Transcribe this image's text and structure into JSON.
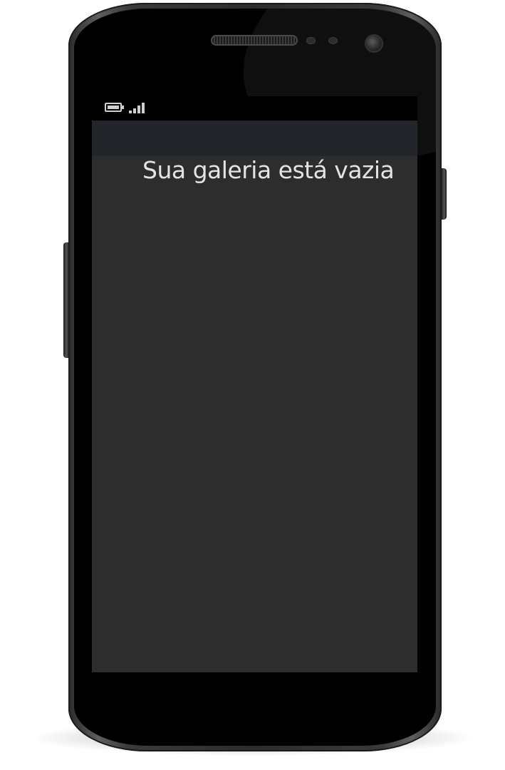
{
  "device": {
    "frame_colors": {
      "bezel": "#000000",
      "body": "#2c2c2c"
    },
    "icons": [
      "speaker-grille-icon",
      "proximity-sensor-icon",
      "front-camera-icon"
    ]
  },
  "status_bar": {
    "icons": [
      "battery-icon",
      "signal-strength-icon"
    ],
    "background": "#000000"
  },
  "action_bar": {
    "title": "",
    "background": "#222529"
  },
  "gallery": {
    "empty_message": "Sua galeria está vazia",
    "background": "#2d2d2d"
  }
}
